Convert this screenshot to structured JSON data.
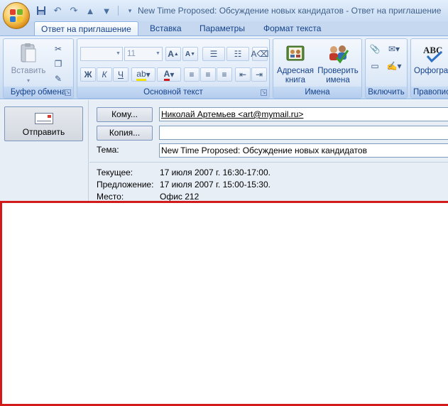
{
  "window": {
    "title": "New Time Proposed: Обсуждение новых кандидатов - Ответ на приглашение"
  },
  "qat": {
    "items": [
      "save-icon",
      "undo-icon",
      "redo-icon",
      "arrow-up-icon",
      "arrow-down-icon",
      "customize-icon"
    ]
  },
  "tabs": [
    {
      "label": "Ответ на приглашение",
      "active": true
    },
    {
      "label": "Вставка"
    },
    {
      "label": "Параметры"
    },
    {
      "label": "Формат текста"
    }
  ],
  "ribbon": {
    "clipboard": {
      "label": "Буфер обмена",
      "paste_label": "Вставить"
    },
    "basic_text": {
      "label": "Основной текст",
      "font_name": "",
      "font_size": "11",
      "bold": "Ж",
      "italic": "К",
      "underline": "Ч"
    },
    "names": {
      "label": "Имена",
      "address_book_label": "Адресная книга",
      "check_names_label": "Проверить имена"
    },
    "include": {
      "label": "Включить"
    },
    "proofing": {
      "label": "Правопис",
      "spelling_label": "Орфогра"
    }
  },
  "form": {
    "send_label": "Отправить",
    "to_button": "Кому...",
    "cc_button": "Копия...",
    "to_value": "Николай Артемьев <art@mymail.ru>",
    "cc_value": "",
    "subject_label": "Тема:",
    "subject_value": "New Time Proposed: Обсуждение новых кандидатов",
    "current_label": "Текущее:",
    "current_value": "17 июля 2007 г. 16:30-17:00.",
    "proposed_label": "Предложение:",
    "proposed_value": "17 июля 2007 г. 15:00-15:30.",
    "location_label": "Место:",
    "location_value": "Офис 212"
  },
  "colors": {
    "accent": "#15428b",
    "highlight": "#d21a1a"
  }
}
